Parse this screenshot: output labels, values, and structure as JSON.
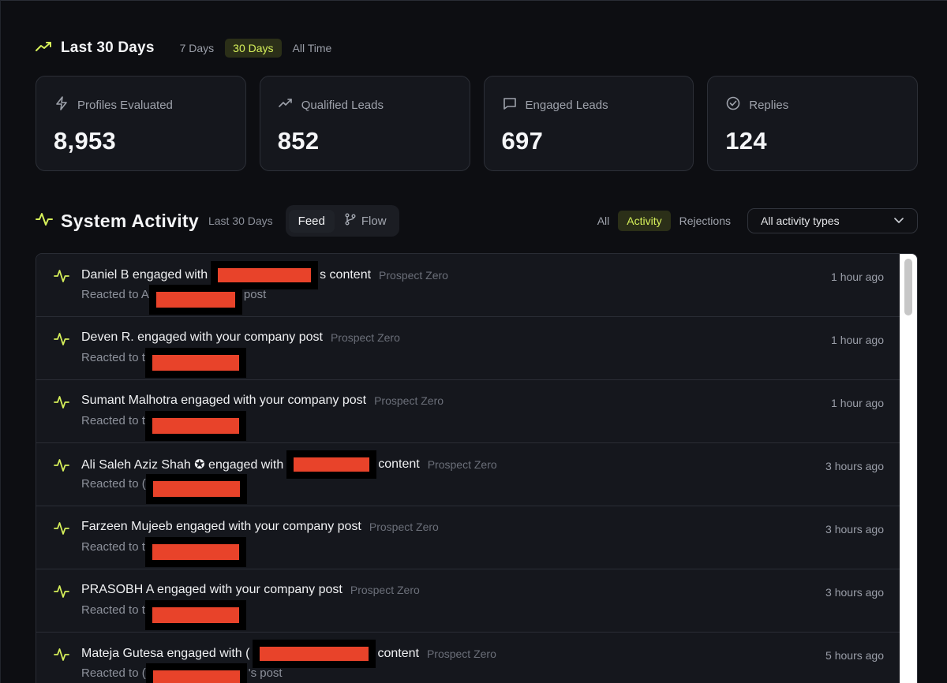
{
  "range": {
    "title": "Last 30 Days",
    "tabs": [
      "7 Days",
      "30 Days",
      "All Time"
    ],
    "active_tab": "30 Days"
  },
  "stats": [
    {
      "label": "Profiles Evaluated",
      "value": "8,953",
      "icon": "lightning-icon"
    },
    {
      "label": "Qualified Leads",
      "value": "852",
      "icon": "trending-up-icon"
    },
    {
      "label": "Engaged Leads",
      "value": "697",
      "icon": "chat-icon"
    },
    {
      "label": "Replies",
      "value": "124",
      "icon": "check-circle-icon"
    }
  ],
  "activity": {
    "title": "System Activity",
    "subtitle": "Last 30 Days",
    "view_tabs": [
      "Feed",
      "Flow"
    ],
    "active_view": "Feed",
    "filters": [
      "All",
      "Activity",
      "Rejections"
    ],
    "active_filter": "Activity",
    "type_select": "All activity types"
  },
  "feed": [
    {
      "pre": "Daniel B engaged with",
      "post": "s content",
      "source": "Prospect Zero",
      "sub_pre": "Reacted to A",
      "sub_post": "post",
      "time": "1 hour ago"
    },
    {
      "pre": "Deven R. engaged with your company post",
      "post": "",
      "source": "Prospect Zero",
      "sub_pre": "Reacted to t",
      "sub_post": "",
      "time": "1 hour ago"
    },
    {
      "pre": "Sumant Malhotra engaged with your company post",
      "post": "",
      "source": "Prospect Zero",
      "sub_pre": "Reacted to t",
      "sub_post": "",
      "time": "1 hour ago"
    },
    {
      "pre": "Ali Saleh Aziz Shah ✪ engaged with",
      "post": "content",
      "source": "Prospect Zero",
      "sub_pre": "Reacted to (",
      "sub_post": "",
      "time": "3 hours ago"
    },
    {
      "pre": "Farzeen Mujeeb engaged with your company post",
      "post": "",
      "source": "Prospect Zero",
      "sub_pre": "Reacted to t",
      "sub_post": "",
      "time": "3 hours ago"
    },
    {
      "pre": "PRASOBH A engaged with your company post",
      "post": "",
      "source": "Prospect Zero",
      "sub_pre": "Reacted to t",
      "sub_post": "",
      "time": "3 hours ago"
    },
    {
      "pre": "Mateja Gutesa engaged with (",
      "post": "content",
      "source": "Prospect Zero",
      "sub_pre": "Reacted to (",
      "sub_post": "'s post",
      "time": "5 hours ago"
    }
  ],
  "colors": {
    "accent": "#d6f05a",
    "redaction": "#e8432a",
    "background": "#0d0e12",
    "card": "#15171d"
  }
}
